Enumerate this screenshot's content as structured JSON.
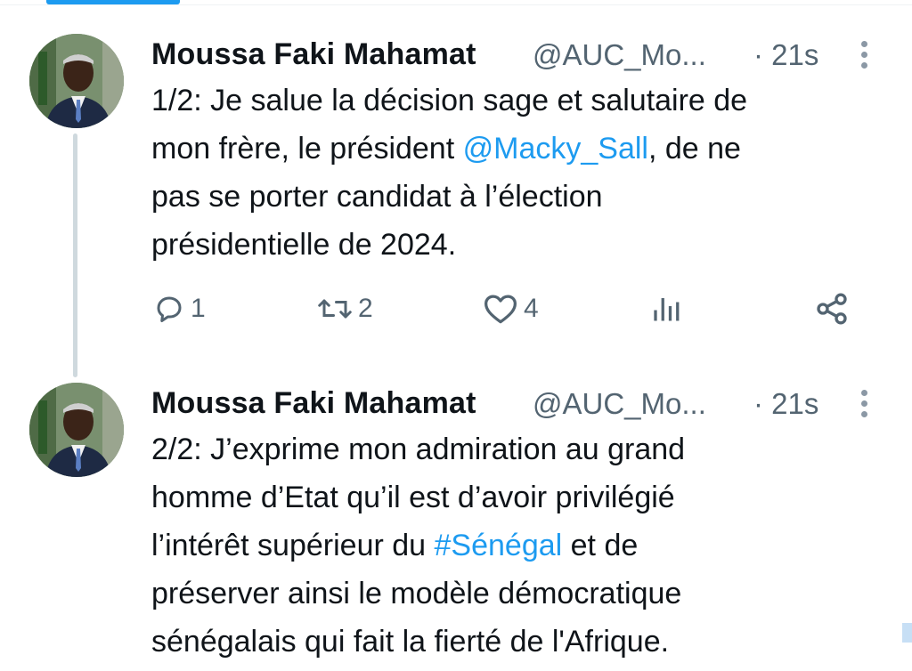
{
  "colors": {
    "link": "#1d9bf0",
    "muted": "#536471",
    "text": "#0f1419",
    "thread_line": "#cfd9de"
  },
  "tweets": [
    {
      "author": {
        "name": "Moussa Faki Mahamat",
        "handle": "@AUC_Mo...",
        "time": "· 21s"
      },
      "text_lines": [
        {
          "before": "1/2: Je salue la décision sage et salutaire de",
          "link": "",
          "after": ""
        },
        {
          "before": "mon frère, le président ",
          "link": "@Macky_Sall",
          "after": ", de ne"
        },
        {
          "before": "pas se porter candidat à l’élection",
          "link": "",
          "after": ""
        },
        {
          "before": "présidentielle de 2024.",
          "link": "",
          "after": ""
        }
      ],
      "actions": {
        "reply": {
          "icon": "reply-icon",
          "count": "1"
        },
        "retweet": {
          "icon": "retweet-icon",
          "count": "2"
        },
        "like": {
          "icon": "heart-icon",
          "count": "4"
        },
        "views": {
          "icon": "views-icon",
          "count": ""
        },
        "share": {
          "icon": "share-icon",
          "count": ""
        }
      }
    },
    {
      "author": {
        "name": "Moussa Faki Mahamat",
        "handle": "@AUC_Mo...",
        "time": "· 21s"
      },
      "text_lines": [
        {
          "before": "2/2: J’exprime mon admiration au grand",
          "link": "",
          "after": ""
        },
        {
          "before": "homme d’Etat qu’il est d’avoir privilégié",
          "link": "",
          "after": ""
        },
        {
          "before": "l’intérêt supérieur du ",
          "link": "#Sénégal",
          "after": " et de"
        },
        {
          "before": "préserver ainsi le modèle démocratique",
          "link": "",
          "after": ""
        },
        {
          "before": "sénégalais qui fait la fierté de l'Afrique.",
          "link": "",
          "after": ""
        }
      ]
    }
  ]
}
